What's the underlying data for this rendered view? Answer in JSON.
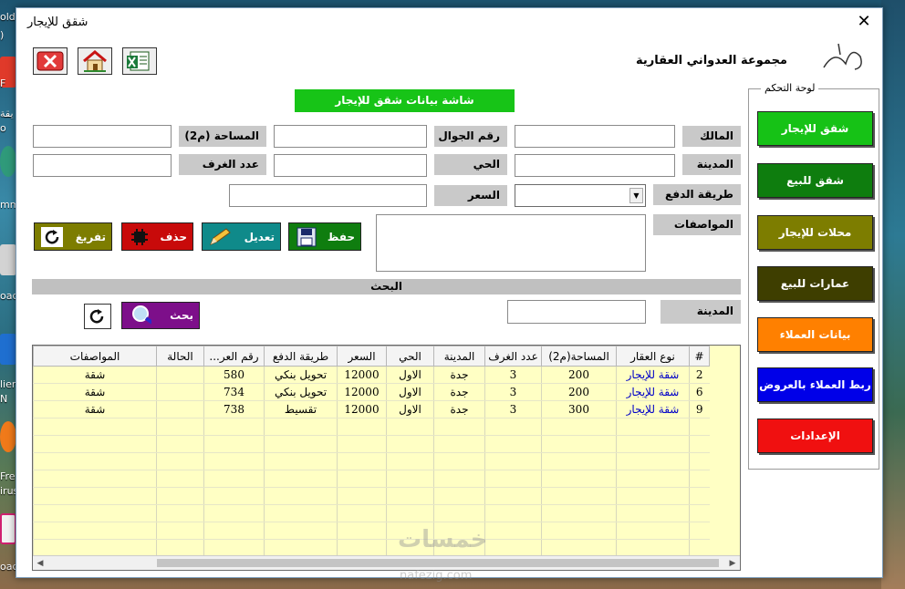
{
  "desktop": {
    "left_texts": [
      "old",
      ")",
      "F",
      "يقة",
      "o",
      "mm",
      "oad",
      "lier",
      "N",
      "Fre",
      "irus",
      "oad"
    ]
  },
  "window": {
    "title": "شقق للإيجار",
    "close_glyph": "✕"
  },
  "header": {
    "company_name": "مجموعة العدواني العقارية",
    "screen_title": "شاشة بيانات شقق للإيجار",
    "logo_caption": "مجموعة العدواني العقارية"
  },
  "toolbar": {
    "icons": [
      "close-form-icon",
      "home-icon",
      "excel-export-icon"
    ]
  },
  "form": {
    "owner_label": "المالك",
    "mobile_label": "رقم الجوال",
    "area_label": "المساحة (م2)",
    "city_label": "المدينة",
    "district_label": "الحي",
    "rooms_label": "عدد الغرف",
    "payment_label": "طريقة الدفع",
    "price_label": "السعر",
    "specs_label": "المواصفات",
    "owner_value": "",
    "mobile_value": "",
    "area_value": "",
    "city_value": "",
    "district_value": "",
    "rooms_value": "",
    "payment_value": "",
    "price_value": "",
    "specs_value": ""
  },
  "actions": {
    "save_label": "حفظ",
    "edit_label": "تعديل",
    "delete_label": "حذف",
    "clear_label": "تفريغ"
  },
  "search": {
    "bar_label": "البحث",
    "city_label": "المدينة",
    "city_value": "",
    "search_label": "بحث"
  },
  "table": {
    "columns": [
      "#",
      "نوع العقار",
      "المساحة(م2)",
      "عدد الغرف",
      "المدينة",
      "الحي",
      "السعر",
      "طريقة الدفع",
      "رقم العر...",
      "الحالة",
      "المواصفات"
    ],
    "rows": [
      [
        "2",
        "شقة للإيجار",
        "200",
        "3",
        "جدة",
        "الاول",
        "12000",
        "تحويل بنكي",
        "580",
        "",
        "شقة"
      ],
      [
        "6",
        "شقة للإيجار",
        "200",
        "3",
        "جدة",
        "الاول",
        "12000",
        "تحويل بنكي",
        "734",
        "",
        "شقة"
      ],
      [
        "9",
        "شقة للإيجار",
        "300",
        "3",
        "جدة",
        "الاول",
        "12000",
        "تقسيط",
        "738",
        "",
        "شقة"
      ]
    ]
  },
  "panel": {
    "legend": "لوحة التحكم",
    "buttons": [
      {
        "label": "شقق للإيجار",
        "color": "#16c216"
      },
      {
        "label": "شقق للبيع",
        "color": "#0e7d0e"
      },
      {
        "label": "محلات للإيجار",
        "color": "#7d7d00"
      },
      {
        "label": "عمارات للبيع",
        "color": "#3e3e00"
      },
      {
        "label": "بيانات العملاء",
        "color": "#ff8000"
      },
      {
        "label": "ربط العملاء بالعروض",
        "color": "#0000e8"
      },
      {
        "label": "الإعدادات",
        "color": "#f01010"
      }
    ]
  },
  "colors": {
    "save": "#0f7d0f",
    "edit": "#0f8a8a",
    "delete": "#c80a0a",
    "clear": "#7d7d00",
    "search": "#7d0f8a"
  },
  "watermark": {
    "text": "خمسات",
    "url": "nafezig.com"
  }
}
